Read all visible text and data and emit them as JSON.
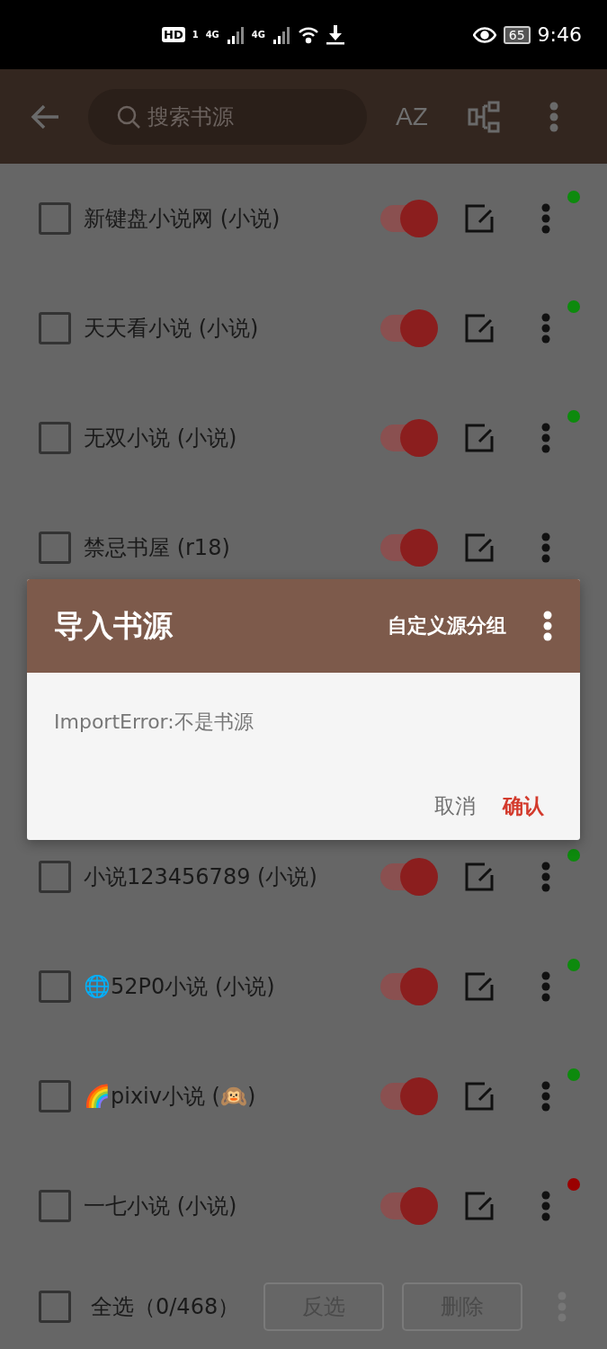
{
  "status_bar": {
    "hd": "HD",
    "sim": "1",
    "networks": [
      "4G",
      "4G"
    ],
    "battery": "65",
    "time": "9:46"
  },
  "toolbar": {
    "search": {
      "placeholder": "搜索书源"
    },
    "sort_label": "AZ"
  },
  "rows_above": [
    {
      "name": "新键盘小说网 (小说)",
      "checked": false,
      "on": true,
      "color": "#0d8a0d"
    },
    {
      "name": "天天看小说 (小说)",
      "checked": false,
      "on": true,
      "color": "#0d8a0d"
    },
    {
      "name": "无双小说 (小说)",
      "checked": false,
      "on": true,
      "color": "#0d8a0d"
    },
    {
      "name": "禁忌书屋 (r18)",
      "checked": false,
      "on": true
    }
  ],
  "rows_below": [
    {
      "name": "小说123456789 (小说)",
      "checked": false,
      "on": true,
      "color": "#0d8a0d"
    },
    {
      "name": "🌐52P0小说 (小说)",
      "checked": false,
      "on": true,
      "color": "#0d8a0d"
    },
    {
      "name": "🌈pixiv小说 (🙉)",
      "checked": false,
      "on": true,
      "color": "#0d8a0d"
    },
    {
      "name": "一七小说 (小说)",
      "checked": false,
      "on": true,
      "color": "#9a0000"
    }
  ],
  "bottom_bar": {
    "select_all": {
      "label": "全选（0/468）",
      "checked": false
    },
    "buttons": [
      "反选",
      "删除"
    ]
  },
  "dialog": {
    "title": "导入书源",
    "group_button": "自定义源分组",
    "message": "ImportError:不是书源",
    "buttons": [
      {
        "label": "取消",
        "kind": "cancel"
      },
      {
        "label": "确认",
        "kind": "confirm"
      }
    ]
  }
}
